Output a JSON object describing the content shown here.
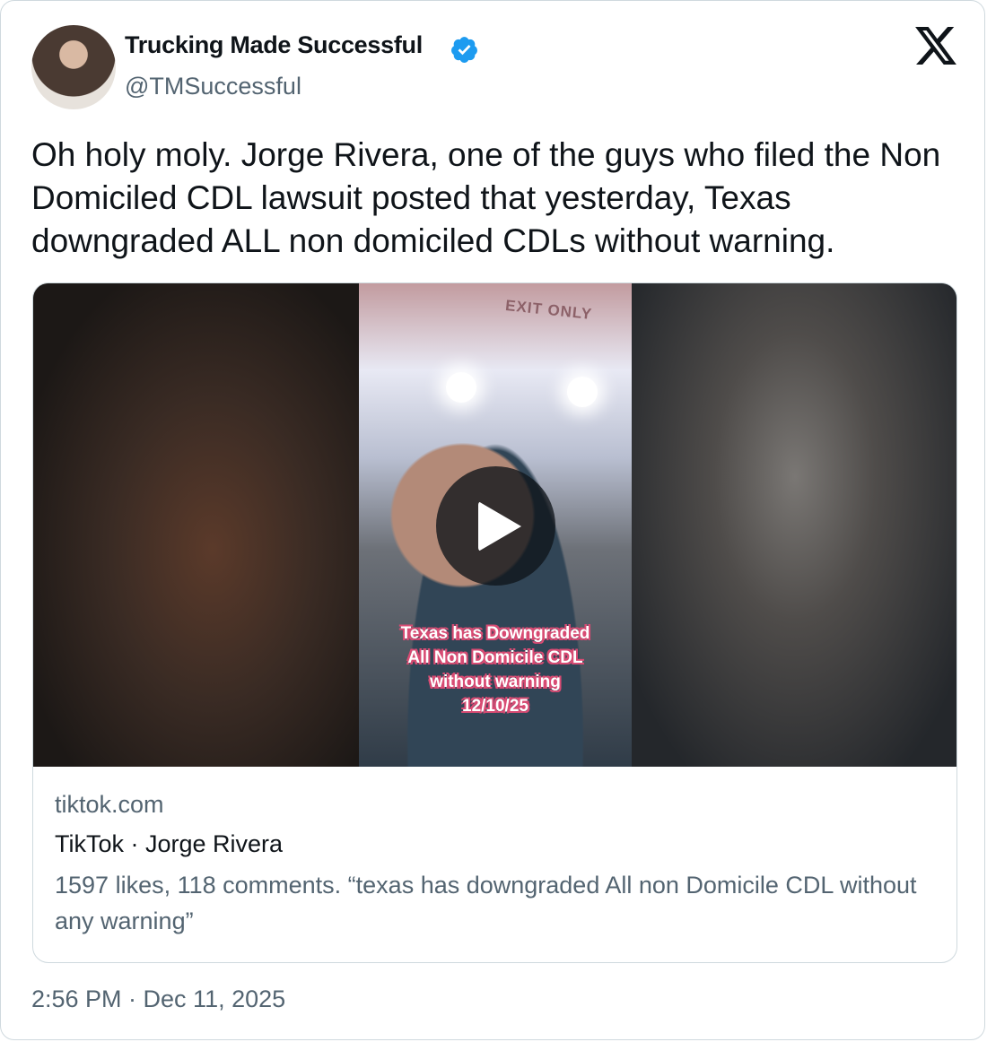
{
  "author": {
    "display_name": "Trucking Made Successful",
    "handle": "@TMSuccessful",
    "verified": true
  },
  "tweet": {
    "text": "Oh holy moly. Jorge Rivera, one of the guys who filed the Non Domiciled CDL lawsuit  posted that yesterday, Texas downgraded ALL non domiciled CDLs without warning.",
    "timestamp": "2:56 PM · Dec 11, 2025"
  },
  "media": {
    "exit_sign": "EXIT ONLY",
    "overlay_lines": [
      "Texas has Downgraded",
      "All Non Domicile CDL",
      "without warning",
      "12/10/25"
    ],
    "play_icon": "play-icon"
  },
  "link_card": {
    "domain": "tiktok.com",
    "title": "TikTok · Jorge Rivera",
    "description": "1597 likes, 118 comments. “texas has downgraded All non Domicile CDL without any warning”"
  },
  "colors": {
    "verified": "#1d9bf0",
    "secondary_text": "#536471",
    "border": "#cfd9de"
  },
  "icons": {
    "verified": "verified-badge-icon",
    "logo": "x-logo-icon"
  }
}
